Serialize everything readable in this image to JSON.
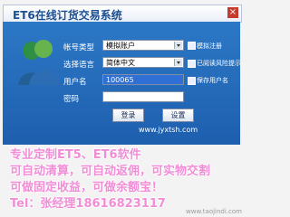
{
  "app": {
    "title": "ET6在线订货交易系统",
    "close_symbol": "×"
  },
  "form": {
    "account_type": {
      "label": "帐号类型",
      "value": "模拟账户"
    },
    "language": {
      "label": "选择语言",
      "value": "简体中文"
    },
    "username": {
      "label": "用户名",
      "value": "100065"
    },
    "password": {
      "label": "密码",
      "value": ""
    },
    "options": {
      "link_remember": "模拟注册",
      "option_one": "已阅读风险提示",
      "option_two": "保存用户名"
    }
  },
  "buttons": {
    "login": "登录",
    "settings": "设置"
  },
  "website": "www.jyxtsh.com",
  "promo": [
    "专业定制ET5、ET6软件",
    "可自动清算，可自动返佣，可实物交割",
    "可做固定收益，可做余额宝！",
    "Tel：张经理18616823117"
  ],
  "watermark": "www.taojindi.com",
  "colors": {
    "panel_blue": "#2c78c6",
    "promo_pink": "#f18dd6",
    "title_blue": "#1b4f91"
  }
}
